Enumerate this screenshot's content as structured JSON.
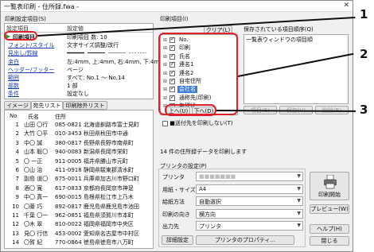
{
  "window": {
    "title": "一覧表印刷 - 住所録.fwa -",
    "close_icon": "close-icon"
  },
  "settings_panel": {
    "title": "印刷設定項目(S)",
    "col_item": "設定項目",
    "col_value": "設定値",
    "items": [
      {
        "label": "印刷項目",
        "value": "印刷項目 数: 10"
      },
      {
        "label": "フォント/スタイル",
        "value": "文字サイズ調整/改行"
      },
      {
        "label": "見出し/罫線",
        "value": ""
      },
      {
        "label": "余白",
        "value": "左:4mm, 上:4mm, 右:4mm, 下:4mm"
      },
      {
        "label": "ヘッダー/フッター",
        "value": "ページ"
      },
      {
        "label": "範囲",
        "value": "すべて: No.1 ～ No.14"
      },
      {
        "label": "部数",
        "value": "1 部"
      },
      {
        "label": "条件",
        "value": "設定なし"
      }
    ]
  },
  "tabs": [
    "イメージ",
    "宛先リスト",
    "印刷除外リスト"
  ],
  "preview_list": {
    "headers": [
      "No",
      "氏名",
      "住所"
    ],
    "rows": [
      {
        "no": "1",
        "name": "山田 〇行",
        "addr": "085-0821 北海道釧路市富士見町"
      },
      {
        "no": "2",
        "name": "大竹 〇平",
        "addr": "010-3453 秋田県秋田市中通"
      },
      {
        "no": "3",
        "name": "中〇 誠",
        "addr": "380-0817 長野県長野市南県町"
      },
      {
        "no": "4",
        "name": "山本 聡〇",
        "addr": "940-0083 新潟県長岡市栄町"
      },
      {
        "no": "5",
        "name": "〇 一正",
        "addr": "911-0005 福井県勝山市元町"
      },
      {
        "no": "6",
        "name": "〇山 治",
        "addr": "411-0918 静岡県駿東郡清水町"
      },
      {
        "no": "7",
        "name": "副島 道〇",
        "addr": "675-0011 兵庫県加古川市野口町"
      },
      {
        "no": "8",
        "name": "酒〇 寛",
        "addr": "617-0833 京都府長岡京市神足"
      },
      {
        "no": "9",
        "name": "中〇 真一",
        "addr": "690-0015 島根県松江市上乃木"
      },
      {
        "no": "10",
        "name": "〇藤 巧",
        "addr": "892-0817 鹿児島県鹿児島市池田"
      },
      {
        "no": "11",
        "name": "千葉 〇一",
        "addr": "962-0851 福島県須賀川市本町"
      },
      {
        "no": "12",
        "name": "〇木 翠",
        "addr": "810-0022 福岡県福岡市中央区"
      },
      {
        "no": "13",
        "name": "見〇 行信",
        "addr": "453-0002 愛知県名古屋市中村区"
      },
      {
        "no": "14",
        "name": "〇賀 紀",
        "addr": "770-0864 徳島県徳島市八万町"
      }
    ]
  },
  "print_items": {
    "title": "印刷項目(I)",
    "clear_label": "クリア(L)",
    "items": [
      {
        "label": "No.",
        "checked": true,
        "selected": false
      },
      {
        "label": "印刷",
        "checked": true,
        "selected": false
      },
      {
        "label": "氏名",
        "checked": true,
        "selected": false
      },
      {
        "label": "連名1",
        "checked": true,
        "selected": false
      },
      {
        "label": "連名2",
        "checked": true,
        "selected": false
      },
      {
        "label": "自宅住所",
        "checked": true,
        "selected": false
      },
      {
        "label": "会社名",
        "checked": true,
        "selected": true
      },
      {
        "label": "通称先(印刷)",
        "checked": true,
        "selected": false
      },
      {
        "label": "年賀状",
        "checked": false,
        "selected": false
      }
    ],
    "up_label": "上へ(U)",
    "down_label": "下へ(D)",
    "hide_empty_label": "■送付先を印刷しない(T)"
  },
  "saved_items": {
    "title": "保存されている項目順序(Q)",
    "first_item": "一覧表ウィンドウの項目順",
    "btn_change": "項目(E)",
    "btn_save": "保存(V)",
    "btn_delete": "削除(R)"
  },
  "status_text": "14 件の住所録データを印刷します",
  "printer_settings": {
    "title": "プリンタの設定(P)",
    "rows": [
      {
        "label": "プリンタ",
        "value": "■■■■■■■"
      },
      {
        "label": "用紙・サイズ",
        "value": "A4"
      },
      {
        "label": "給紙方法",
        "value": "自動選択"
      },
      {
        "label": "印刷の向き",
        "value": "横方向"
      },
      {
        "label": "出力先",
        "value": "プリンタ"
      }
    ],
    "detail_label": "詳細設定",
    "properties_label": "プリンタのプロパティ..."
  },
  "side_buttons": {
    "print_label": "印刷開始",
    "preview_label": "プレビュー(W)",
    "help_label": "ヘルプ(H)",
    "close_label": "閉じる"
  },
  "callouts": [
    "1",
    "2",
    "3"
  ],
  "colors": {
    "accent_red": "#e0202a",
    "selected_blue": "#3a7bd5",
    "link_blue": "#1a3fb0"
  }
}
